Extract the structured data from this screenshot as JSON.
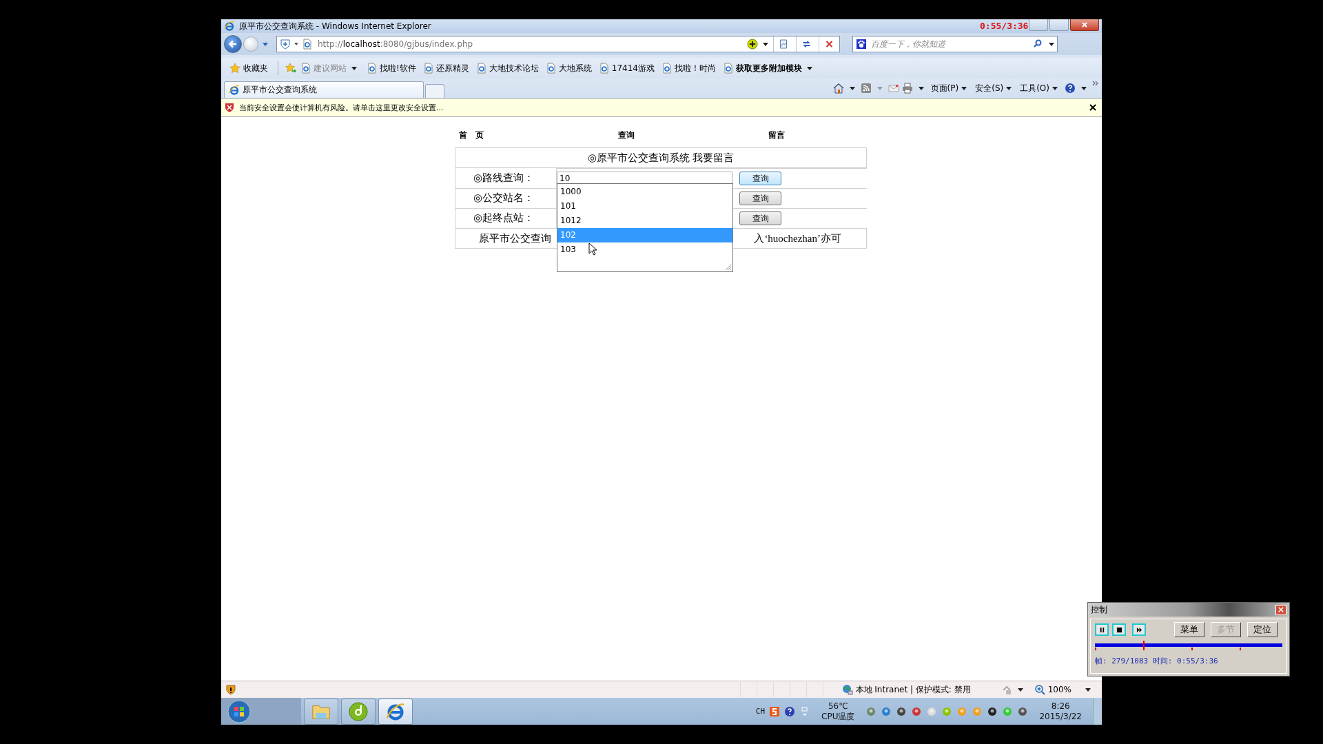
{
  "window": {
    "title": "原平市公交查询系统 - Windows Internet Explorer"
  },
  "recorder_overlay": "0:55/3:36",
  "address_bar": {
    "url_scheme": "http://",
    "url_host": "localhost",
    "url_path": ":8080/gjbus/index.php"
  },
  "search": {
    "placeholder": "百度一下，你就知道"
  },
  "favorites": {
    "label": "收藏夹",
    "items": [
      {
        "label": "建议网站",
        "kind": "suggested"
      },
      {
        "label": "找啦!软件",
        "kind": "link"
      },
      {
        "label": "还原精灵",
        "kind": "link"
      },
      {
        "label": "大地技术论坛",
        "kind": "link"
      },
      {
        "label": "大地系统",
        "kind": "link"
      },
      {
        "label": "17414游戏",
        "kind": "link"
      },
      {
        "label": "找啦！时尚",
        "kind": "link"
      },
      {
        "label": "获取更多附加模块",
        "kind": "addon"
      }
    ]
  },
  "tabs": [
    {
      "label": "原平市公交查询系统",
      "selected": true
    }
  ],
  "command_bar": [
    {
      "label": "页面(P)"
    },
    {
      "label": "安全(S)"
    },
    {
      "label": "工具(O)"
    }
  ],
  "info_bar": {
    "text": "当前安全设置会使计算机有风险。请单击这里更改安全设置..."
  },
  "page": {
    "nav": [
      "首　页",
      "查询",
      "留言"
    ],
    "heading": "◎原平市公交查询系统 我要留言",
    "rows": [
      {
        "label": "◎路线查询：",
        "value": "10",
        "button": "查询",
        "focused": true
      },
      {
        "label": "◎公交站名：",
        "button": "查询",
        "focused": false
      },
      {
        "label": "◎起终点站：",
        "button": "查询",
        "focused": false
      }
    ],
    "note_left": "原平市公交查询",
    "note_right": "入‘huochezhan’亦可",
    "autocomplete": [
      {
        "label": "1000",
        "selected": false
      },
      {
        "label": "101",
        "selected": false
      },
      {
        "label": "1012",
        "selected": false
      },
      {
        "label": "102",
        "selected": true
      },
      {
        "label": "103",
        "selected": false
      }
    ]
  },
  "status_bar": {
    "zone": "本地 Intranet | 保护模式: 禁用",
    "zoom": "100%"
  },
  "taskbar": {
    "apps": [
      {
        "kind": "folder",
        "selected": false
      },
      {
        "kind": "disc",
        "selected": false
      },
      {
        "kind": "browser",
        "selected": true
      }
    ],
    "lang": "CH",
    "temp": "56℃",
    "temp_label": "CPU温度",
    "time": "8:26",
    "date": "2015/3/22"
  },
  "player": {
    "title": "控制",
    "buttons": [
      {
        "label": "菜单",
        "disabled": false
      },
      {
        "label": "多节",
        "disabled": true
      },
      {
        "label": "定位",
        "disabled": false
      }
    ],
    "level": 0.2576,
    "status": "帧: 279/1083 时间: 0:55/3:36"
  }
}
